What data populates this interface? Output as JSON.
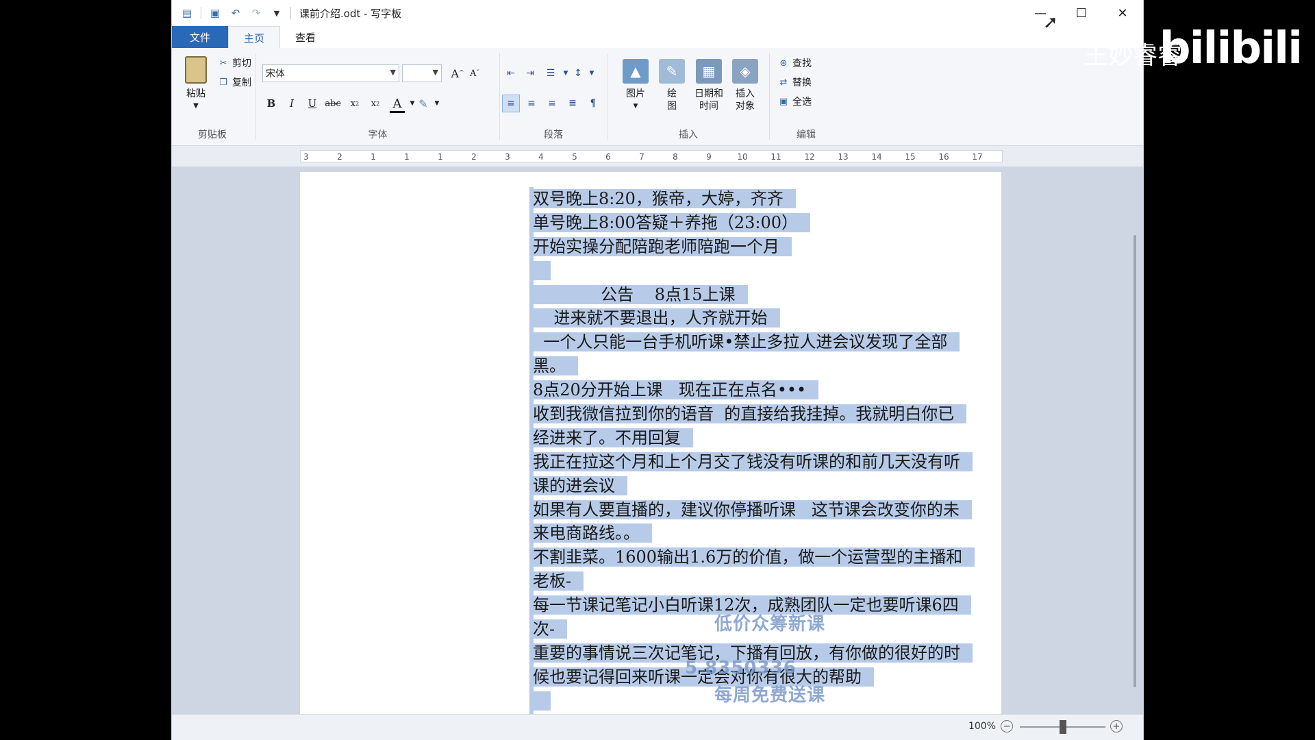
{
  "window": {
    "title": "课前介绍.odt - 写字板"
  },
  "tabs": [
    "文件",
    "主页",
    "查看"
  ],
  "ribbon": {
    "clipboard": {
      "paste": "粘贴",
      "cut": "剪切",
      "copy": "复制",
      "label": "剪贴板"
    },
    "font": {
      "family": "宋体",
      "size": "",
      "label": "字体"
    },
    "paragraph": {
      "label": "段落"
    },
    "insert": {
      "picture": "图片",
      "paint": "绘\n图",
      "datetime": "日期和\n时间",
      "object": "插入\n对象",
      "label": "插入"
    },
    "edit": {
      "find": "查找",
      "replace": "替换",
      "selectall": "全选",
      "label": "编辑"
    }
  },
  "ruler": {
    "marks": [
      "3",
      "2",
      "1",
      "1",
      "1",
      "2",
      "3",
      "4",
      "5",
      "6",
      "7",
      "8",
      "9",
      "10",
      "11",
      "12",
      "13",
      "14",
      "15",
      "16",
      "17"
    ]
  },
  "document": {
    "lines": [
      "双号晚上8:20，猴帝，大婷，齐齐",
      "单号晚上8:00答疑＋养拖（23:00）",
      "开始实操分配陪跑老师陪跑一个月",
      " ",
      "             公告    8点15上课",
      "    进来就不要退出，人齐就开始",
      "  一个人只能一台手机听课•禁止多拉人进会议发现了全部",
      "黑。",
      "8点20分开始上课   现在正在点名•••",
      "收到我微信拉到你的语音  的直接给我挂掉。我就明白你已",
      "经进来了。不用回复",
      "我正在拉这个月和上个月交了钱没有听课的和前几天没有听",
      "课的进会议",
      "如果有人要直播的，建议你停播听课   这节课会改变你的未",
      "来电商路线。。",
      "不割韭菜。1600输出1.6万的价值，做一个运营型的主播和",
      "老板-",
      "每一节课记笔记小白听课12次，成熟团队一定也要听课6四",
      "次-",
      "重要的事情说三次记笔记，下播有回放，有你做的很好的时",
      "候也要记得回来听课一定会对你有很大的帮助",
      " "
    ]
  },
  "status": {
    "zoom": "100%"
  },
  "overlay": {
    "watermark1": "低价众筹新课",
    "watermark2": "5 8350336",
    "watermark3": "每周免费送课",
    "bili_user": "王妙睿睿",
    "bili_brand": "bilibili"
  }
}
